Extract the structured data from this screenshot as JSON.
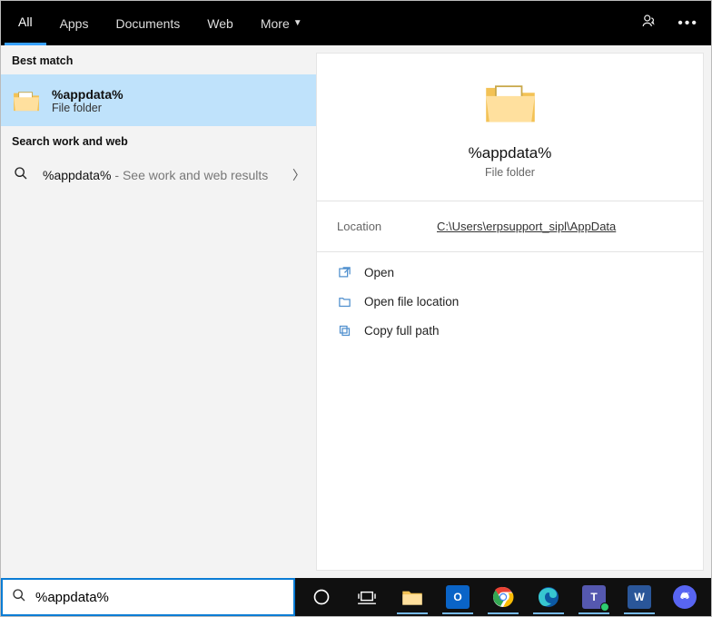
{
  "tabs": {
    "all": "All",
    "apps": "Apps",
    "documents": "Documents",
    "web": "Web",
    "more": "More"
  },
  "sections": {
    "best_match": "Best match",
    "search_web": "Search work and web"
  },
  "best_match": {
    "title": "%appdata%",
    "subtitle": "File folder"
  },
  "web_result": {
    "term": "%appdata%",
    "suffix": " - See work and web results"
  },
  "preview": {
    "title": "%appdata%",
    "subtitle": "File folder",
    "location_label": "Location",
    "location_value": "C:\\Users\\erpsupport_sipl\\AppData"
  },
  "actions": {
    "open": "Open",
    "open_location": "Open file location",
    "copy_path": "Copy full path"
  },
  "search": {
    "value": "%appdata%"
  }
}
